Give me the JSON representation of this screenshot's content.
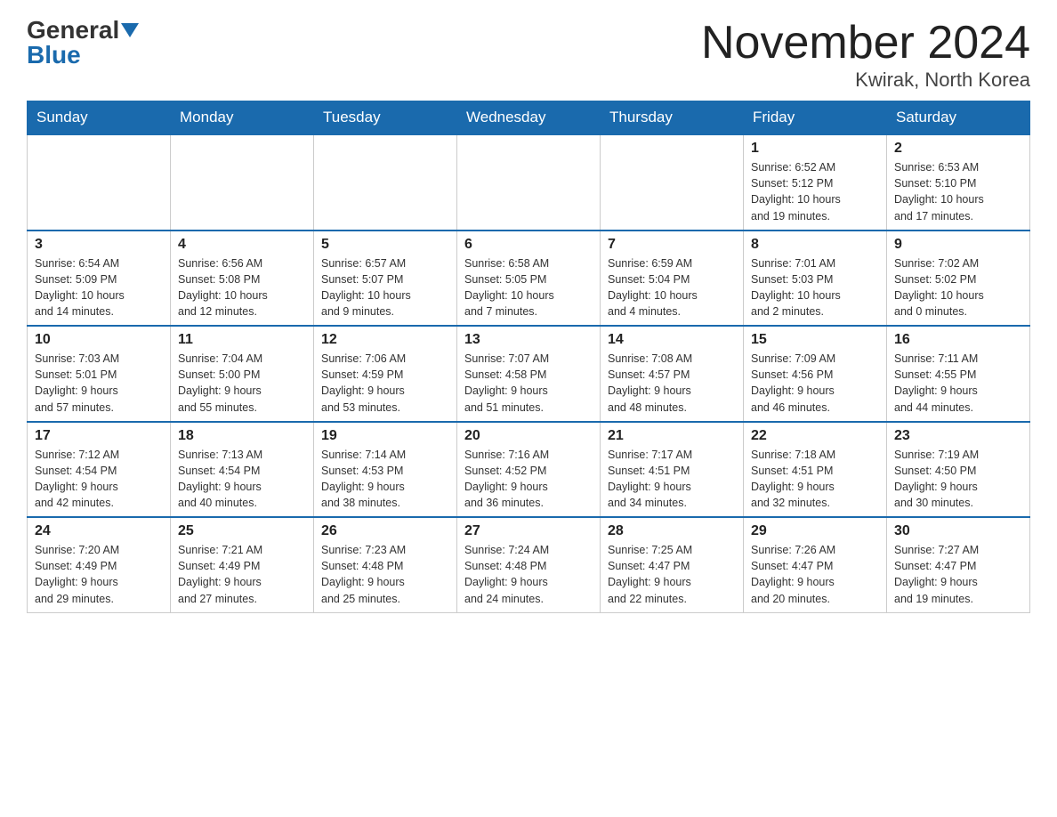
{
  "header": {
    "logo_general": "General",
    "logo_blue": "Blue",
    "month_title": "November 2024",
    "location": "Kwirak, North Korea"
  },
  "days_of_week": [
    "Sunday",
    "Monday",
    "Tuesday",
    "Wednesday",
    "Thursday",
    "Friday",
    "Saturday"
  ],
  "weeks": [
    [
      {
        "day": "",
        "info": ""
      },
      {
        "day": "",
        "info": ""
      },
      {
        "day": "",
        "info": ""
      },
      {
        "day": "",
        "info": ""
      },
      {
        "day": "",
        "info": ""
      },
      {
        "day": "1",
        "info": "Sunrise: 6:52 AM\nSunset: 5:12 PM\nDaylight: 10 hours\nand 19 minutes."
      },
      {
        "day": "2",
        "info": "Sunrise: 6:53 AM\nSunset: 5:10 PM\nDaylight: 10 hours\nand 17 minutes."
      }
    ],
    [
      {
        "day": "3",
        "info": "Sunrise: 6:54 AM\nSunset: 5:09 PM\nDaylight: 10 hours\nand 14 minutes."
      },
      {
        "day": "4",
        "info": "Sunrise: 6:56 AM\nSunset: 5:08 PM\nDaylight: 10 hours\nand 12 minutes."
      },
      {
        "day": "5",
        "info": "Sunrise: 6:57 AM\nSunset: 5:07 PM\nDaylight: 10 hours\nand 9 minutes."
      },
      {
        "day": "6",
        "info": "Sunrise: 6:58 AM\nSunset: 5:05 PM\nDaylight: 10 hours\nand 7 minutes."
      },
      {
        "day": "7",
        "info": "Sunrise: 6:59 AM\nSunset: 5:04 PM\nDaylight: 10 hours\nand 4 minutes."
      },
      {
        "day": "8",
        "info": "Sunrise: 7:01 AM\nSunset: 5:03 PM\nDaylight: 10 hours\nand 2 minutes."
      },
      {
        "day": "9",
        "info": "Sunrise: 7:02 AM\nSunset: 5:02 PM\nDaylight: 10 hours\nand 0 minutes."
      }
    ],
    [
      {
        "day": "10",
        "info": "Sunrise: 7:03 AM\nSunset: 5:01 PM\nDaylight: 9 hours\nand 57 minutes."
      },
      {
        "day": "11",
        "info": "Sunrise: 7:04 AM\nSunset: 5:00 PM\nDaylight: 9 hours\nand 55 minutes."
      },
      {
        "day": "12",
        "info": "Sunrise: 7:06 AM\nSunset: 4:59 PM\nDaylight: 9 hours\nand 53 minutes."
      },
      {
        "day": "13",
        "info": "Sunrise: 7:07 AM\nSunset: 4:58 PM\nDaylight: 9 hours\nand 51 minutes."
      },
      {
        "day": "14",
        "info": "Sunrise: 7:08 AM\nSunset: 4:57 PM\nDaylight: 9 hours\nand 48 minutes."
      },
      {
        "day": "15",
        "info": "Sunrise: 7:09 AM\nSunset: 4:56 PM\nDaylight: 9 hours\nand 46 minutes."
      },
      {
        "day": "16",
        "info": "Sunrise: 7:11 AM\nSunset: 4:55 PM\nDaylight: 9 hours\nand 44 minutes."
      }
    ],
    [
      {
        "day": "17",
        "info": "Sunrise: 7:12 AM\nSunset: 4:54 PM\nDaylight: 9 hours\nand 42 minutes."
      },
      {
        "day": "18",
        "info": "Sunrise: 7:13 AM\nSunset: 4:54 PM\nDaylight: 9 hours\nand 40 minutes."
      },
      {
        "day": "19",
        "info": "Sunrise: 7:14 AM\nSunset: 4:53 PM\nDaylight: 9 hours\nand 38 minutes."
      },
      {
        "day": "20",
        "info": "Sunrise: 7:16 AM\nSunset: 4:52 PM\nDaylight: 9 hours\nand 36 minutes."
      },
      {
        "day": "21",
        "info": "Sunrise: 7:17 AM\nSunset: 4:51 PM\nDaylight: 9 hours\nand 34 minutes."
      },
      {
        "day": "22",
        "info": "Sunrise: 7:18 AM\nSunset: 4:51 PM\nDaylight: 9 hours\nand 32 minutes."
      },
      {
        "day": "23",
        "info": "Sunrise: 7:19 AM\nSunset: 4:50 PM\nDaylight: 9 hours\nand 30 minutes."
      }
    ],
    [
      {
        "day": "24",
        "info": "Sunrise: 7:20 AM\nSunset: 4:49 PM\nDaylight: 9 hours\nand 29 minutes."
      },
      {
        "day": "25",
        "info": "Sunrise: 7:21 AM\nSunset: 4:49 PM\nDaylight: 9 hours\nand 27 minutes."
      },
      {
        "day": "26",
        "info": "Sunrise: 7:23 AM\nSunset: 4:48 PM\nDaylight: 9 hours\nand 25 minutes."
      },
      {
        "day": "27",
        "info": "Sunrise: 7:24 AM\nSunset: 4:48 PM\nDaylight: 9 hours\nand 24 minutes."
      },
      {
        "day": "28",
        "info": "Sunrise: 7:25 AM\nSunset: 4:47 PM\nDaylight: 9 hours\nand 22 minutes."
      },
      {
        "day": "29",
        "info": "Sunrise: 7:26 AM\nSunset: 4:47 PM\nDaylight: 9 hours\nand 20 minutes."
      },
      {
        "day": "30",
        "info": "Sunrise: 7:27 AM\nSunset: 4:47 PM\nDaylight: 9 hours\nand 19 minutes."
      }
    ]
  ]
}
